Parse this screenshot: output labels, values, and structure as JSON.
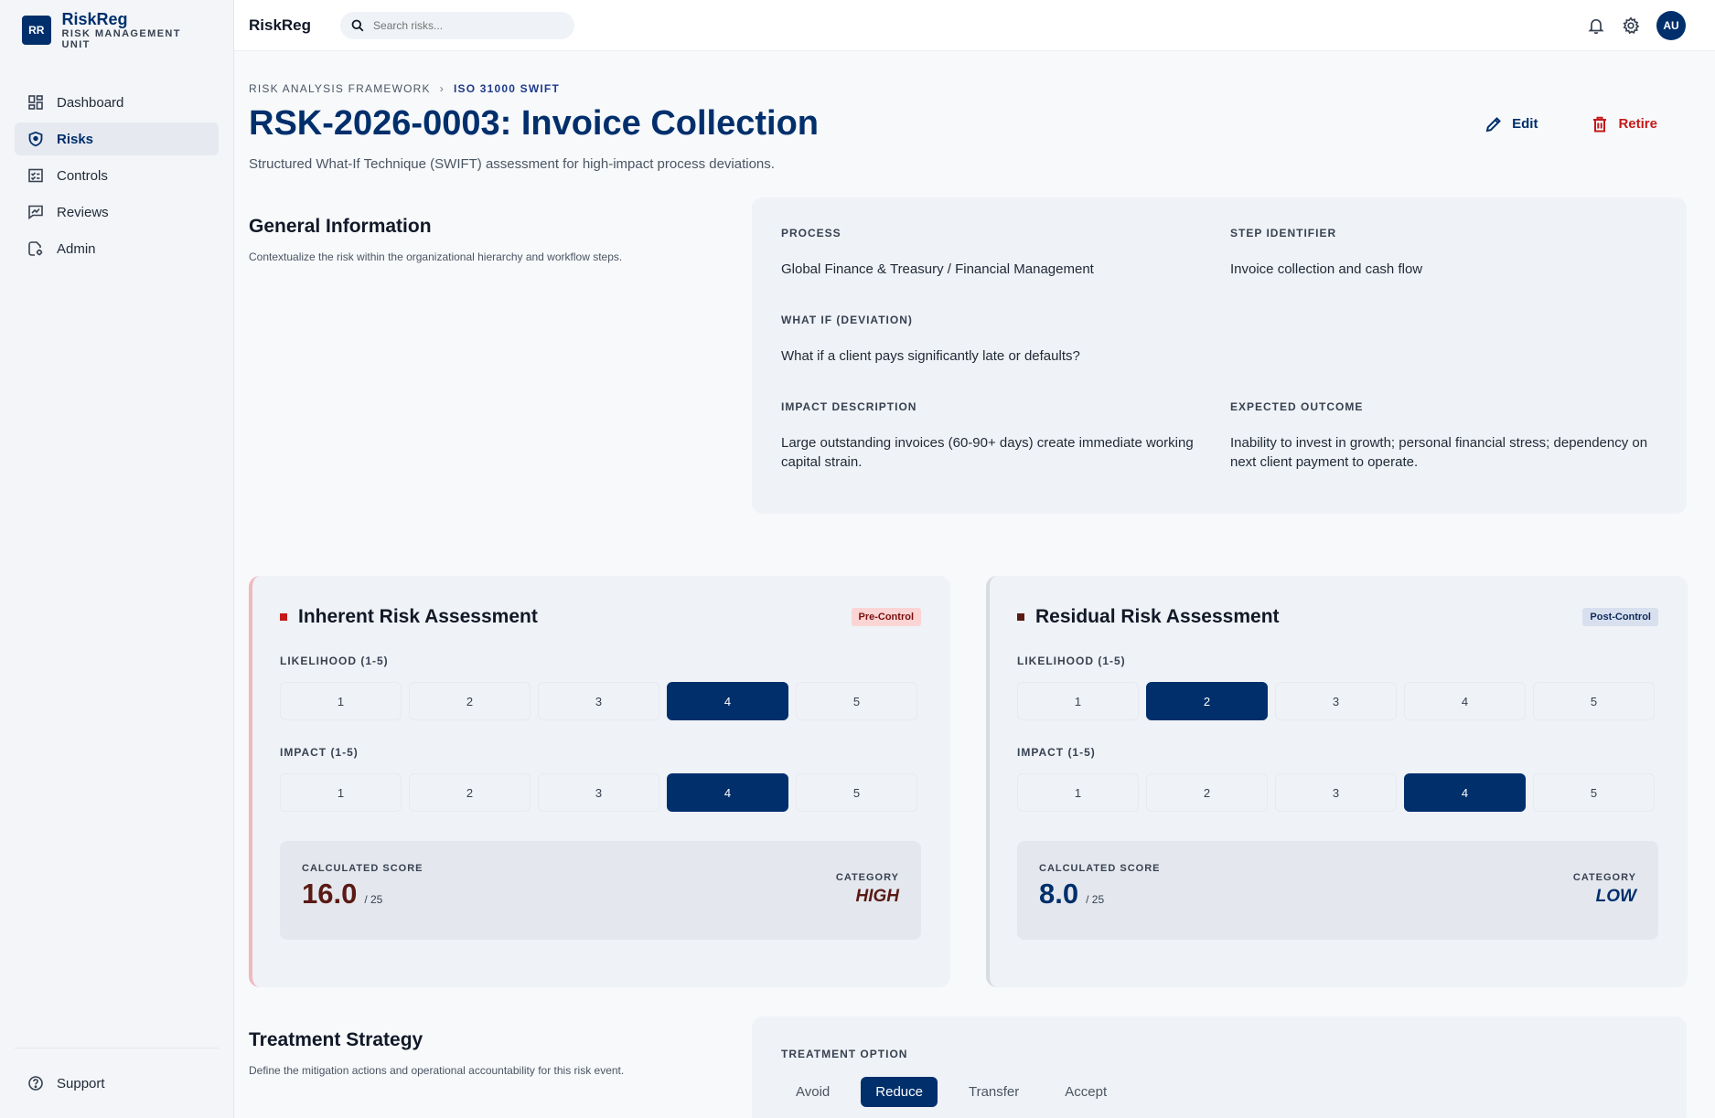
{
  "brand": {
    "logo": "RR",
    "name": "RiskReg",
    "subtitle": "RISK MANAGEMENT UNIT"
  },
  "nav": {
    "items": [
      {
        "label": "Dashboard",
        "icon": "dashboard-icon"
      },
      {
        "label": "Risks",
        "icon": "shield-icon",
        "active": true
      },
      {
        "label": "Controls",
        "icon": "checklist-icon"
      },
      {
        "label": "Reviews",
        "icon": "chart-review-icon"
      },
      {
        "label": "Admin",
        "icon": "admin-gear-icon"
      }
    ],
    "support": "Support"
  },
  "topbar": {
    "title": "RiskReg",
    "search_placeholder": "Search risks...",
    "avatar": "AU"
  },
  "breadcrumb": {
    "parent": "RISK ANALYSIS FRAMEWORK",
    "current": "ISO 31000 SWIFT"
  },
  "header": {
    "title": "RSK-2026-0003: Invoice Collection",
    "description": "Structured What-If Technique (SWIFT) assessment for high-impact process deviations.",
    "edit_label": "Edit",
    "retire_label": "Retire"
  },
  "general": {
    "title": "General Information",
    "description": "Contextualize the risk within the organizational hierarchy and workflow steps.",
    "process_label": "PROCESS",
    "process_value": "Global Finance & Treasury / Financial Management",
    "step_label": "STEP IDENTIFIER",
    "step_value": "Invoice collection and cash flow",
    "whatif_label": "WHAT IF (DEVIATION)",
    "whatif_value": "What if a client pays significantly late or defaults?",
    "impact_label": "IMPACT DESCRIPTION",
    "impact_value": "Large outstanding invoices (60-90+ days) create immediate working capital strain.",
    "outcome_label": "EXPECTED OUTCOME",
    "outcome_value": "Inability to invest in growth; personal financial stress; dependency on next client payment to operate."
  },
  "inherent": {
    "title": "Inherent Risk Assessment",
    "badge": "Pre-Control",
    "likelihood_label": "LIKELIHOOD (1-5)",
    "impact_label": "IMPACT (1-5)",
    "options": [
      "1",
      "2",
      "3",
      "4",
      "5"
    ],
    "likelihood": 4,
    "impact": 4,
    "score_label": "CALCULATED SCORE",
    "score": "16.0",
    "score_max": "/ 25",
    "category_label": "CATEGORY",
    "category": "HIGH"
  },
  "residual": {
    "title": "Residual Risk Assessment",
    "badge": "Post-Control",
    "likelihood_label": "LIKELIHOOD (1-5)",
    "impact_label": "IMPACT (1-5)",
    "options": [
      "1",
      "2",
      "3",
      "4",
      "5"
    ],
    "likelihood": 2,
    "impact": 4,
    "score_label": "CALCULATED SCORE",
    "score": "8.0",
    "score_max": "/ 25",
    "category_label": "CATEGORY",
    "category": "LOW"
  },
  "treatment": {
    "title": "Treatment Strategy",
    "description": "Define the mitigation actions and operational accountability for this risk event.",
    "option_label": "TREATMENT OPTION",
    "options": [
      "Avoid",
      "Reduce",
      "Transfer",
      "Accept"
    ],
    "selected": "Reduce"
  },
  "colors": {
    "primary": "#002f6c",
    "danger": "#c41a1a",
    "surface": "#eff2f6"
  }
}
